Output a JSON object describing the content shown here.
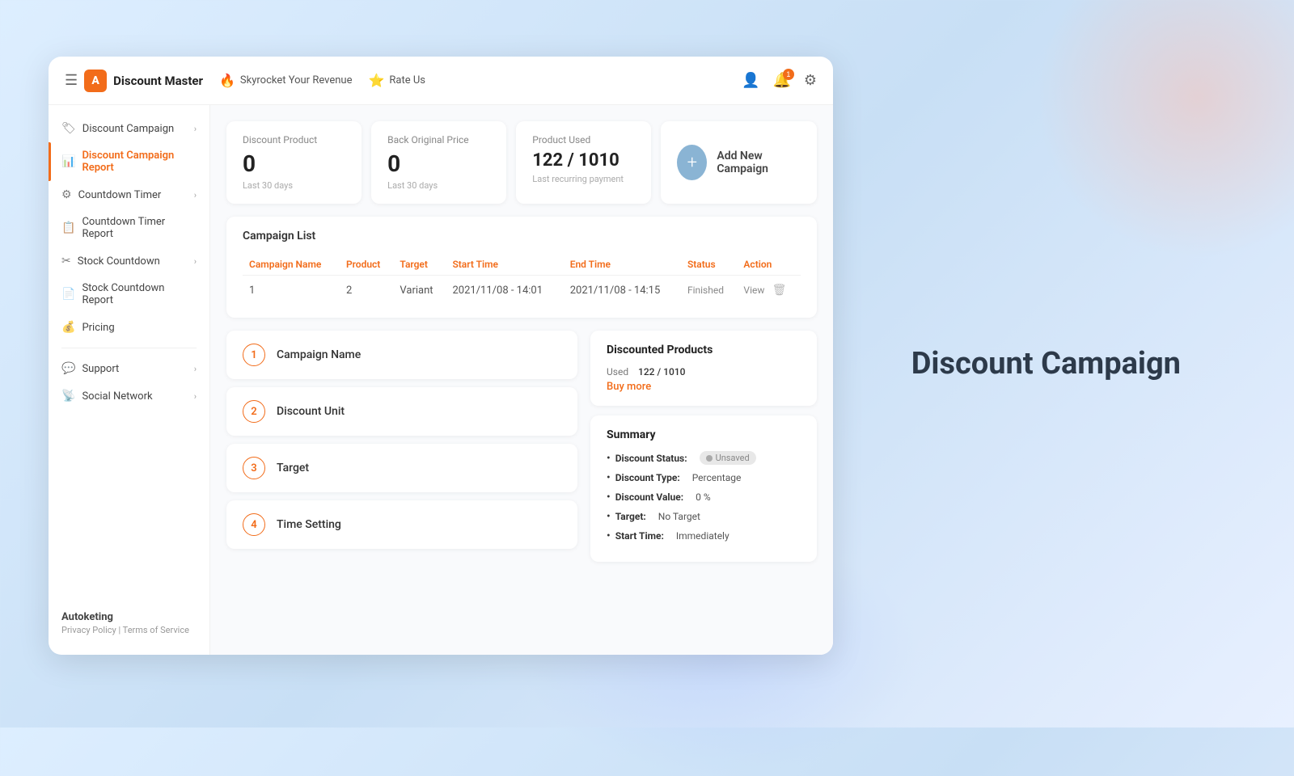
{
  "app": {
    "logo_letter": "A",
    "logo_text": "Discount Master",
    "nav": [
      {
        "icon": "🔥",
        "label": "Skyrocket Your Revenue"
      },
      {
        "icon": "⭐",
        "label": "Rate Us"
      }
    ],
    "actions": [
      {
        "icon": "👤",
        "badge": null,
        "name": "user"
      },
      {
        "icon": "🔔",
        "badge": "1",
        "name": "notification"
      },
      {
        "icon": "⚙",
        "badge": null,
        "name": "settings"
      }
    ]
  },
  "sidebar": {
    "items": [
      {
        "icon": "🏷",
        "label": "Discount Campaign",
        "active": false,
        "has_chevron": true
      },
      {
        "icon": "📊",
        "label": "Discount Campaign Report",
        "active": true,
        "has_chevron": false
      },
      {
        "icon": "⚙",
        "label": "Countdown Timer",
        "active": false,
        "has_chevron": true
      },
      {
        "icon": "📋",
        "label": "Countdown Timer Report",
        "active": false,
        "has_chevron": false
      },
      {
        "icon": "✂",
        "label": "Stock Countdown",
        "active": false,
        "has_chevron": true
      },
      {
        "icon": "📄",
        "label": "Stock Countdown Report",
        "active": false,
        "has_chevron": false
      },
      {
        "icon": "💰",
        "label": "Pricing",
        "active": false,
        "has_chevron": false
      }
    ],
    "bottom_items": [
      {
        "icon": "💬",
        "label": "Support",
        "has_chevron": true
      },
      {
        "icon": "📡",
        "label": "Social Network",
        "has_chevron": true
      }
    ],
    "brand": "Autoketing",
    "privacy_label": "Privacy Policy",
    "terms_label": "Terms of Service"
  },
  "stats": [
    {
      "label": "Discount Product",
      "value": "0",
      "sub": "Last 30 days"
    },
    {
      "label": "Back Original Price",
      "value": "0",
      "sub": "Last 30 days"
    },
    {
      "label": "Product Used",
      "value": "122 / 1010",
      "sub": "Last recurring payment"
    }
  ],
  "add_campaign": {
    "label": "Add New Campaign"
  },
  "campaign_list": {
    "title": "Campaign List",
    "columns": [
      "Campaign Name",
      "Product",
      "Target",
      "Start Time",
      "End Time",
      "Status",
      "Action"
    ],
    "rows": [
      {
        "name": "1",
        "product": "2",
        "target": "Variant",
        "start_time": "2021/11/08 - 14:01",
        "end_time": "2021/11/08 - 14:15",
        "status": "Finished",
        "action_view": "View"
      }
    ]
  },
  "form": {
    "steps": [
      {
        "num": "1",
        "label": "Campaign Name"
      },
      {
        "num": "2",
        "label": "Discount Unit"
      },
      {
        "num": "3",
        "label": "Target"
      },
      {
        "num": "4",
        "label": "Time Setting"
      }
    ]
  },
  "discounted_products": {
    "title": "Discounted Products",
    "used_label": "Used",
    "used_value": "122 / 1010",
    "buy_more": "Buy more"
  },
  "summary": {
    "title": "Summary",
    "items": [
      {
        "label": "Discount Status:",
        "value": "Unsaved",
        "is_badge": true
      },
      {
        "label": "Discount Type:",
        "value": "Percentage"
      },
      {
        "label": "Discount Value:",
        "value": "0 %"
      },
      {
        "label": "Target:",
        "value": "No Target"
      },
      {
        "label": "Start Time:",
        "value": "Immediately"
      }
    ]
  },
  "right_title": "Discount Campaign"
}
